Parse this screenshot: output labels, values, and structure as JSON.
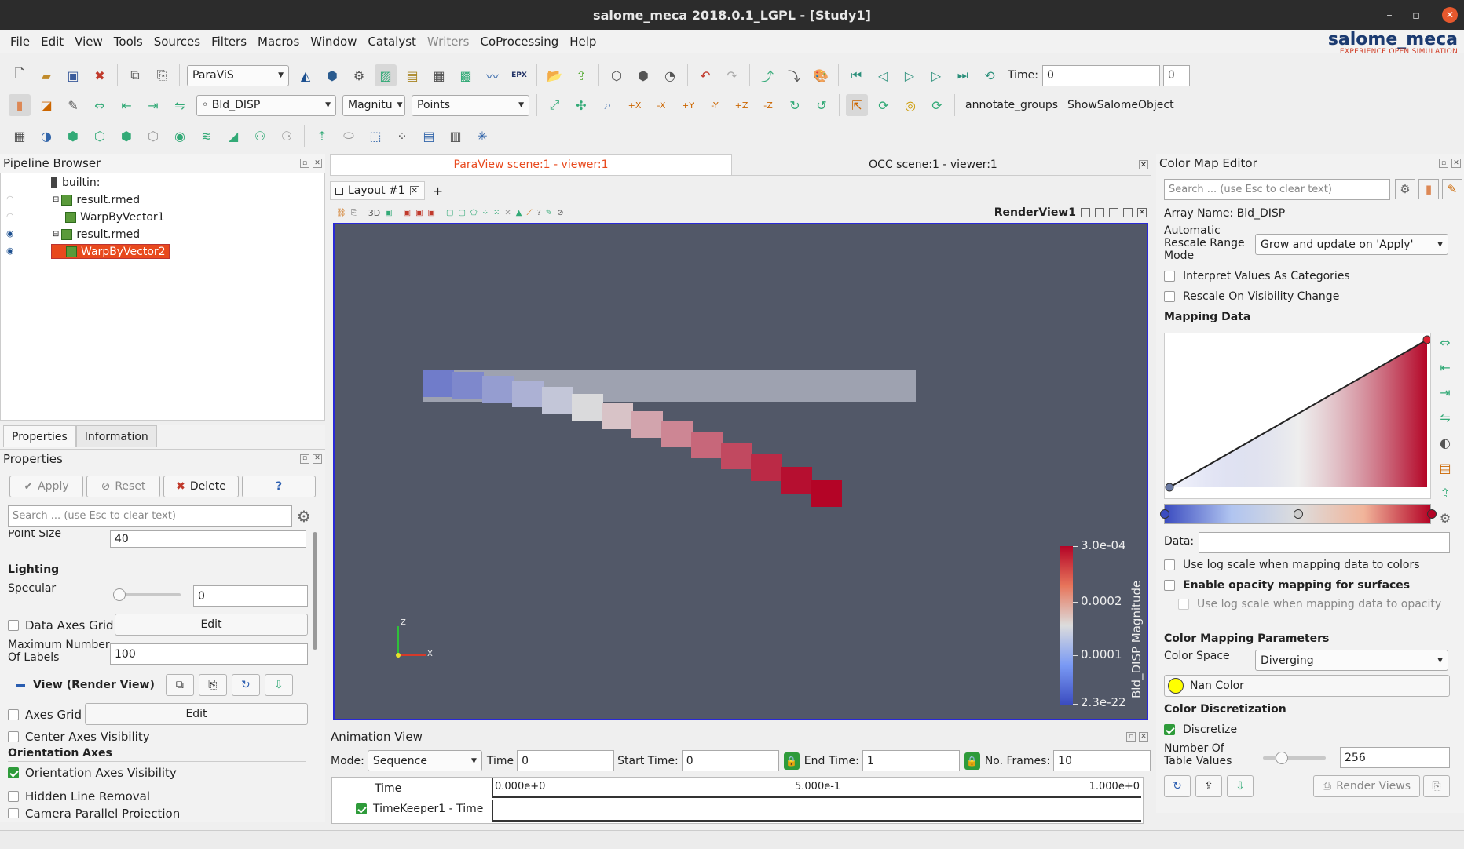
{
  "window": {
    "title": "salome_meca 2018.0.1_LGPL - [Study1]"
  },
  "menu": [
    "File",
    "Edit",
    "View",
    "Tools",
    "Sources",
    "Filters",
    "Macros",
    "Window",
    "Catalyst",
    "Writers",
    "CoProcessing",
    "Help"
  ],
  "menu_disabled": [
    "Writers"
  ],
  "logo": {
    "name": "salome_meca",
    "tagline": "EXPERIENCE OPEN SIMULATION"
  },
  "toolbar": {
    "module": "ParaViS",
    "array": "Bld_DISP",
    "component": "Magnitu",
    "representation": "Points",
    "time_label": "Time:",
    "time_value": "0",
    "time_step": "0",
    "epx_label": "EPX",
    "annotate_groups": "annotate_groups",
    "show_salome_object": "ShowSalomeObject"
  },
  "pipeline": {
    "title": "Pipeline Browser",
    "items": [
      {
        "label": "builtin:",
        "level": 0
      },
      {
        "label": "result.rmed",
        "level": 1
      },
      {
        "label": "WarpByVector1",
        "level": 2
      },
      {
        "label": "result.rmed",
        "level": 1
      },
      {
        "label": "WarpByVector2",
        "level": 2,
        "selected": true
      }
    ]
  },
  "properties": {
    "tabs": [
      "Properties",
      "Information"
    ],
    "title": "Properties",
    "apply": "Apply",
    "reset": "Reset",
    "delete": "Delete",
    "help": "?",
    "search_placeholder": "Search ... (use Esc to clear text)",
    "point_size_label": "Point Size",
    "point_size": "40",
    "lighting": "Lighting",
    "specular_label": "Specular",
    "specular": "0",
    "data_axes_grid": "Data Axes Grid",
    "edit": "Edit",
    "max_labels_label": "Maximum Number Of Labels",
    "max_labels": "100",
    "view_section": "View (Render View)",
    "axes_grid": "Axes Grid",
    "center_axes": "Center Axes Visibility",
    "orientation_axes": "Orientation Axes",
    "orientation_axes_vis": "Orientation Axes Visibility",
    "hidden_line": "Hidden Line Removal",
    "camera_parallel": "Camera Parallel Projection"
  },
  "viewer": {
    "tab_paraview": "ParaView scene:1 - viewer:1",
    "tab_occ": "OCC scene:1 - viewer:1",
    "layout_tab": "Layout #1",
    "render_view": "RenderView1",
    "three_d": "3D",
    "colorbar": {
      "title": "Bld_DISP Magnitude",
      "max": "3.0e-04",
      "t1": "0.0002",
      "t2": "0.0001",
      "min": "2.3e-22"
    },
    "axes": {
      "z": "Z",
      "x": "X"
    }
  },
  "animation": {
    "title": "Animation View",
    "mode_label": "Mode:",
    "mode": "Sequence",
    "time_label": "Time",
    "time": "0",
    "start_label": "Start Time:",
    "start": "0",
    "end_label": "End Time:",
    "end": "1",
    "frames_label": "No. Frames:",
    "frames": "10",
    "track_header": "Time",
    "track": "TimeKeeper1 - Time",
    "ticks": [
      "0.000e+0",
      "5.000e-1",
      "1.000e+0"
    ]
  },
  "colormap": {
    "title": "Color Map Editor",
    "search_placeholder": "Search ... (use Esc to clear text)",
    "array_name": "Array Name: Bld_DISP",
    "auto_rescale_label": "Automatic Rescale Range Mode",
    "auto_rescale": "Grow and update on 'Apply'",
    "interpret_categories": "Interpret Values As Categories",
    "rescale_visibility": "Rescale On Visibility Change",
    "mapping_data": "Mapping Data",
    "data_label": "Data:",
    "log_scale": "Use log scale when mapping data to colors",
    "opacity_mapping": "Enable opacity mapping for surfaces",
    "log_opacity": "Use log scale when mapping data to opacity",
    "params": "Color Mapping Parameters",
    "color_space_label": "Color Space",
    "color_space": "Diverging",
    "nan_color": "Nan Color",
    "discretization": "Color Discretization",
    "discretize": "Discretize",
    "table_values_label": "Number Of Table Values",
    "table_values": "256",
    "render_views": "Render Views"
  },
  "colors": {
    "viewport": "#525868",
    "selection": "#e8491d",
    "accent_red": "#b40426",
    "accent_blue": "#3b4cc0"
  },
  "beam_segments": [
    0.05,
    0.1,
    0.18,
    0.26,
    0.34,
    0.42,
    0.5,
    0.58,
    0.66,
    0.74,
    0.82,
    0.9,
    0.97,
    1.0
  ],
  "ghost_beam": true
}
